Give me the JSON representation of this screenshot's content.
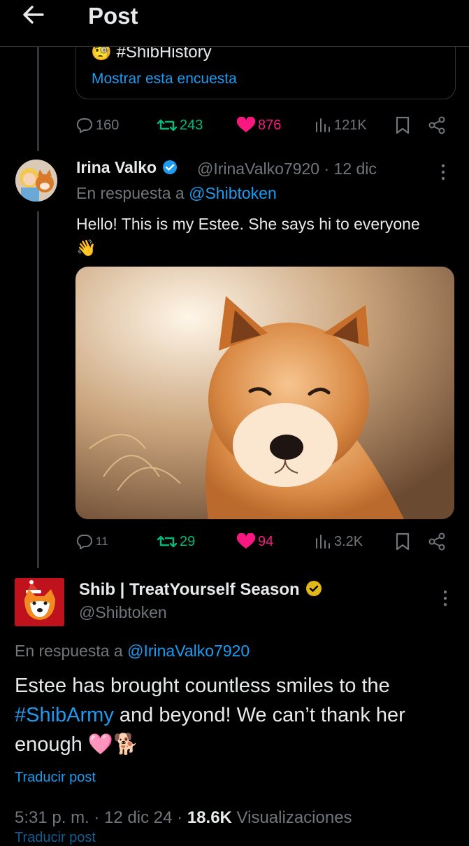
{
  "header": {
    "back_icon": "arrow-left-icon",
    "title": "Post"
  },
  "poll": {
    "emoji": "🧐",
    "hashtag": "#ShibHistory",
    "show_poll": "Mostrar esta encuesta"
  },
  "post0_actions": {
    "replies": "160",
    "reposts": "243",
    "likes": "876",
    "views": "121K"
  },
  "reply_post": {
    "name": "Irina Valko",
    "handle": "@IrinaValko7920",
    "dot": "·",
    "date": "12 dic",
    "reply_prefix": "En respuesta a",
    "reply_mention": "@Shibtoken",
    "text": "Hello! This is my Estee. She says hi to everyone",
    "text_emoji": "👋",
    "actions": {
      "replies": "11",
      "reposts": "29",
      "likes": "94",
      "views": "3.2K"
    }
  },
  "main_post": {
    "name": "Shib | TreatYourself Season",
    "handle": "@Shibtoken",
    "reply_prefix": "En respuesta a",
    "reply_mention": "@IrinaValko7920",
    "text_part1": "Estee has brought countless smiles to the",
    "hashtag": "#ShibArmy",
    "text_part2": " and beyond! We can’t thank her enough",
    "emojis": "🩷🐕",
    "translate": "Traducir post",
    "time": "5:31 p. m.",
    "sep": "·",
    "date": "12 dic 24",
    "views_count": "18.6K",
    "views_label": "Visualizaciones",
    "ghost_text": "Traducir post"
  },
  "colors": {
    "accent": "#1d9bf0",
    "repost": "#00ba7c",
    "like": "#f91880",
    "muted": "#71767b",
    "verified_blue": "#1d9bf0",
    "verified_gold": "#e2b719"
  }
}
